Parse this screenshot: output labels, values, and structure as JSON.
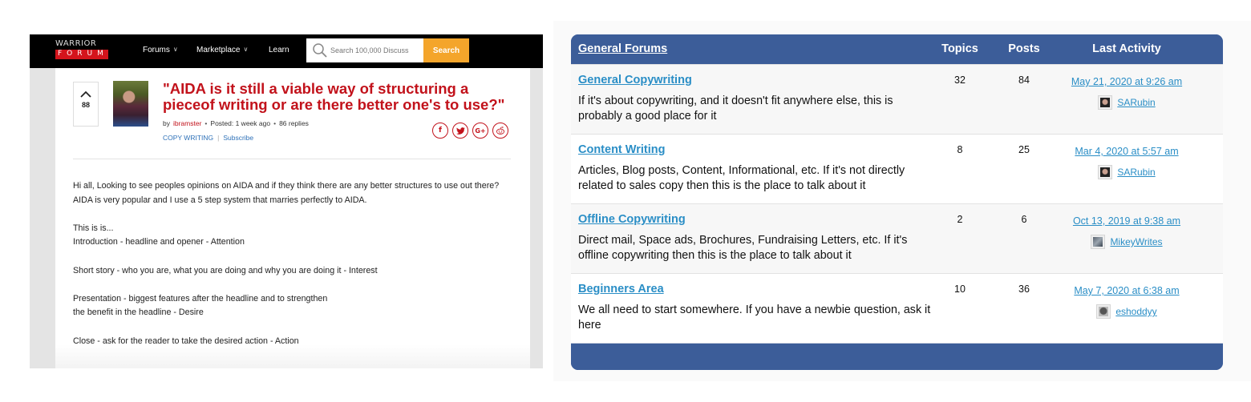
{
  "left_panel": {
    "nav": {
      "logo_top": "WARRIOR",
      "logo_bottom": "FORUM",
      "links": [
        {
          "label": "Forums",
          "has_dropdown": true
        },
        {
          "label": "Marketplace",
          "has_dropdown": true
        },
        {
          "label": "Learn",
          "has_dropdown": false
        }
      ],
      "search_placeholder": "Search 100,000 Discuss",
      "search_button": "Search",
      "chevron_glyph": "∨"
    },
    "post": {
      "vote_icon": "chevron-up-icon",
      "vote_count": "88",
      "title": "\"AIDA is it still a viable way of structuring a pieceof writing or are there better one's to use?\"",
      "by_label": "by",
      "author": "ibramster",
      "posted": "Posted: 1 week ago",
      "replies": "86 replies",
      "bullet": "•",
      "category": "COPY WRITING",
      "tag_separator": "|",
      "subscribe": "Subscribe",
      "share_icons": [
        {
          "name": "facebook-icon",
          "glyph": "f"
        },
        {
          "name": "twitter-icon",
          "glyph": "ᵬ"
        },
        {
          "name": "google-plus-icon",
          "glyph": "G+"
        },
        {
          "name": "reddit-icon",
          "glyph": "☺"
        }
      ],
      "body": [
        {
          "text": "Hi all, Looking to see peoples opinions on AIDA and if they think there are any better structures to use out there?",
          "gap": false
        },
        {
          "text": "AIDA is very popular and I use a 5 step system that marries perfectly to AIDA.",
          "gap": false
        },
        {
          "text": "This is is...",
          "gap": true
        },
        {
          "text": "Introduction - headline and opener - Attention",
          "gap": false
        },
        {
          "text": "Short story - who you are, what you are doing and why you are doing it - Interest",
          "gap": true
        },
        {
          "text": "Presentation - biggest features after the headline and to strengthen",
          "gap": true
        },
        {
          "text": "the benefit in the headline - Desire",
          "gap": false
        },
        {
          "text": "Close - ask for the reader to take the desired action - Action",
          "gap": true
        }
      ]
    }
  },
  "right_panel": {
    "header": {
      "title": "General Forums",
      "col_topics": "Topics",
      "col_posts": "Posts",
      "col_activity": "Last Activity"
    },
    "colors": {
      "header_bg": "#3c5d99",
      "link": "#2a8ec6"
    },
    "forums": [
      {
        "name": "General Copywriting",
        "description": "If it's about copywriting, and it doesn't fit anywhere else, this is probably a good place for it",
        "topics": "32",
        "posts": "84",
        "last_activity": "May 21, 2020 at 9:26 am",
        "user": "SARubin"
      },
      {
        "name": "Content Writing",
        "description": "Articles, Blog posts, Content, Informational, etc. If it's not directly related to sales copy then this is the place to talk about it",
        "topics": "8",
        "posts": "25",
        "last_activity": "Mar 4, 2020 at 5:57 am",
        "user": "SARubin"
      },
      {
        "name": "Offline Copywriting",
        "description": "Direct mail, Space ads, Brochures, Fundraising Letters, etc. If it's offline copywriting then this is the place to talk about it",
        "topics": "2",
        "posts": "6",
        "last_activity": "Oct 13, 2019 at 9:38 am",
        "user": "MikeyWrites"
      },
      {
        "name": "Beginners Area",
        "description": "We all need to start somewhere. If you have a newbie question, ask it here",
        "topics": "10",
        "posts": "36",
        "last_activity": "May 7, 2020 at 6:38 am",
        "user": "eshoddyy"
      }
    ]
  }
}
